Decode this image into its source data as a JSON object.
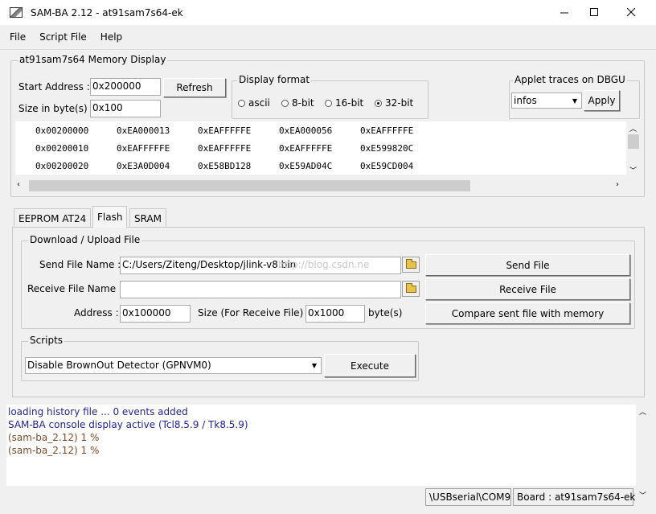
{
  "window": {
    "title": "SAM-BA 2.12  - at91sam7s64-ek"
  },
  "menu": [
    "File",
    "Script File",
    "Help"
  ],
  "memory": {
    "group_title": "at91sam7s64 Memory Display",
    "start_label": "Start Address :",
    "start_value": "0x200000",
    "size_label": "Size in byte(s) :",
    "size_value": "0x100",
    "refresh_label": "Refresh",
    "format_title": "Display format",
    "formats": [
      "ascii",
      "8-bit",
      "16-bit",
      "32-bit"
    ],
    "selected_format": "32-bit",
    "applet_title": "Applet traces on DBGU",
    "applet_value": "infos",
    "apply_label": "Apply",
    "rows": [
      {
        "addr": "0x00200000",
        "cells": [
          "0xEA000013",
          "0xEAFFFFFE",
          "0xEA000056",
          "0xEAFFFFFE"
        ]
      },
      {
        "addr": "0x00200010",
        "cells": [
          "0xEAFFFFFE",
          "0xEAFFFFFE",
          "0xEAFFFFFE",
          "0xE599820C"
        ]
      },
      {
        "addr": "0x00200020",
        "cells": [
          "0xE3A0D004",
          "0xE58BD128",
          "0xE59AD04C",
          "0xE59CD004"
        ]
      }
    ]
  },
  "tabs": [
    "EEPROM AT24",
    "Flash",
    "SRAM"
  ],
  "active_tab": "Flash",
  "flash": {
    "group_title": "Download / Upload File",
    "send_label": "Send File Name :",
    "send_value": "C:/Users/Ziteng/Desktop/jlink-v8.bin",
    "receive_label": "Receive File Name :",
    "receive_value": "",
    "address_label": "Address :",
    "address_value": "0x100000",
    "size_label": "Size (For Receive File) :",
    "size_value": "0x1000",
    "bytes_label": "byte(s)",
    "send_button": "Send File",
    "receive_button": "Receive File",
    "compare_button": "Compare sent file with memory",
    "watermark": "http://blog.csdn.ne"
  },
  "scripts": {
    "group_title": "Scripts",
    "selected": "Disable BrownOut Detector (GPNVM0)",
    "execute_label": "Execute"
  },
  "console": {
    "lines": [
      {
        "text": "loading history file ... 0 events added",
        "color": "#1f1f9a"
      },
      {
        "text": "SAM-BA console display active (Tcl8.5.9 / Tk8.5.9)",
        "color": "#1f1f9a"
      },
      {
        "text": "(sam-ba_2.12) 1 %",
        "color": "#7a4a2a"
      },
      {
        "text": "(sam-ba_2.12) 1 %",
        "color": "#7a4a2a"
      }
    ]
  },
  "status": {
    "connection": "\\USBserial\\COM9",
    "board": "Board : at91sam7s64-ek"
  }
}
